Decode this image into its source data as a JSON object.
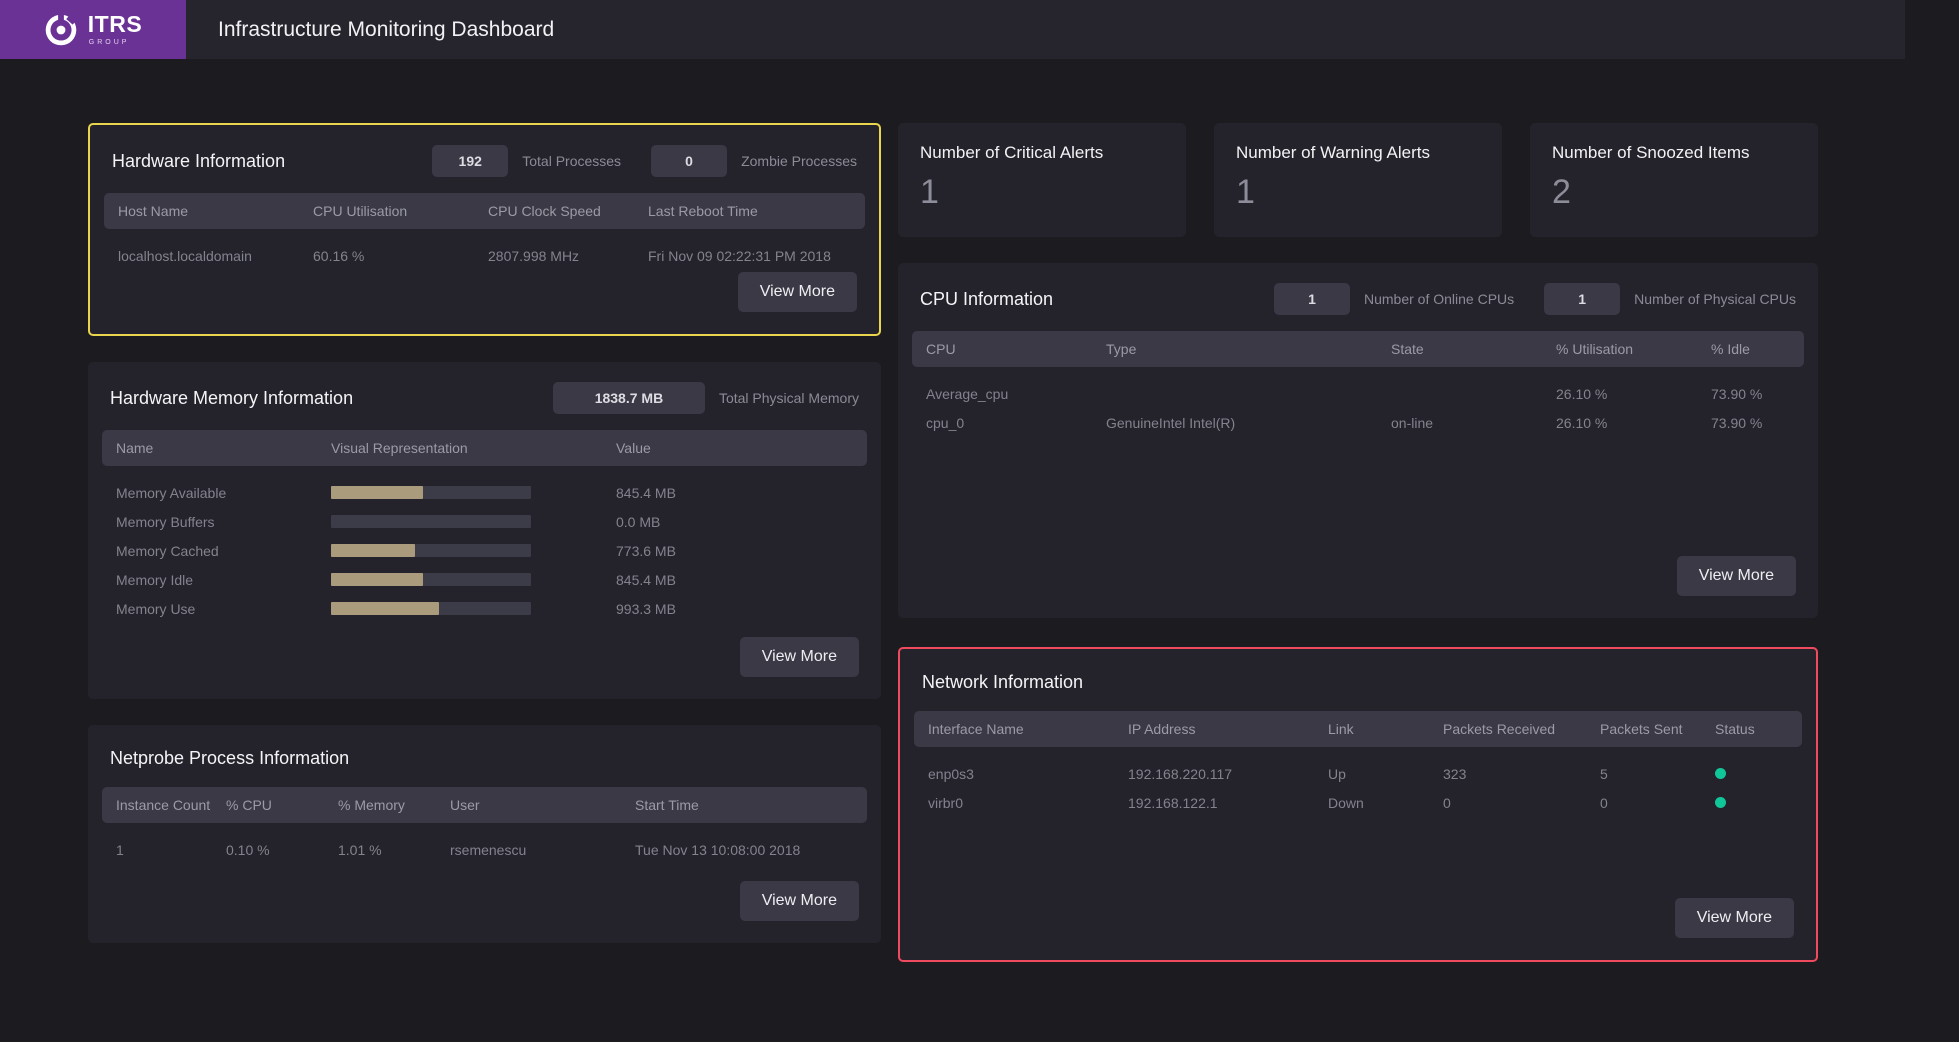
{
  "header": {
    "brand_name": "ITRS",
    "brand_sub": "GROUP",
    "brand_color": "#6b3296",
    "title": "Infrastructure Monitoring Dashboard"
  },
  "common": {
    "view_more_label": "View More",
    "status_dot_color": "#10c79a"
  },
  "hardware_information": {
    "title": "Hardware Information",
    "border_color": "#e8d44d",
    "kpis": [
      {
        "value": "192",
        "label": "Total Processes"
      },
      {
        "value": "0",
        "label": "Zombie Processes"
      }
    ],
    "columns": [
      "Host Name",
      "CPU Utilisation",
      "CPU Clock Speed",
      "Last Reboot Time"
    ],
    "rows": [
      {
        "host_name": "localhost.localdomain",
        "cpu_utilisation": "60.16 %",
        "cpu_clock_speed": "2807.998 MHz",
        "last_reboot_time": "Fri Nov 09 02:22:31 PM 2018"
      }
    ]
  },
  "hardware_memory_information": {
    "title": "Hardware Memory Information",
    "kpis": [
      {
        "value": "1838.7 MB",
        "label": "Total Physical Memory"
      }
    ],
    "columns": [
      "Name",
      "Visual Representation",
      "Value"
    ],
    "rows": [
      {
        "name": "Memory Available",
        "percent": 46,
        "value": "845.4 MB"
      },
      {
        "name": "Memory Buffers",
        "percent": 0,
        "value": "0.0 MB"
      },
      {
        "name": "Memory Cached",
        "percent": 42,
        "value": "773.6 MB"
      },
      {
        "name": "Memory Idle",
        "percent": 46,
        "value": "845.4 MB"
      },
      {
        "name": "Memory Use",
        "percent": 54,
        "value": "993.3 MB"
      }
    ]
  },
  "netprobe_process_information": {
    "title": "Netprobe Process Information",
    "columns": [
      "Instance Count",
      "% CPU",
      "% Memory",
      "User",
      "Start Time"
    ],
    "rows": [
      {
        "instance_count": "1",
        "pct_cpu": "0.10 %",
        "pct_memory": "1.01 %",
        "user": "rsemenescu",
        "start_time": "Tue Nov 13 10:08:00 2018"
      }
    ]
  },
  "stat_cards": [
    {
      "title": "Number of Critical Alerts",
      "value": "1"
    },
    {
      "title": "Number of Warning Alerts",
      "value": "1"
    },
    {
      "title": "Number of Snoozed Items",
      "value": "2"
    }
  ],
  "cpu_information": {
    "title": "CPU Information",
    "kpis": [
      {
        "value": "1",
        "label": "Number of Online CPUs"
      },
      {
        "value": "1",
        "label": "Number of Physical CPUs"
      }
    ],
    "columns": [
      "CPU",
      "Type",
      "State",
      "% Utilisation",
      "% Idle"
    ],
    "rows": [
      {
        "cpu": "Average_cpu",
        "type": "",
        "state": "",
        "utilisation": "26.10 %",
        "idle": "73.90 %"
      },
      {
        "cpu": "cpu_0",
        "type": "GenuineIntel Intel(R)",
        "state": "on-line",
        "utilisation": "26.10 %",
        "idle": "73.90 %"
      }
    ]
  },
  "network_information": {
    "title": "Network Information",
    "border_color": "#ef4a5e",
    "columns": [
      "Interface Name",
      "IP Address",
      "Link",
      "Packets Received",
      "Packets Sent",
      "Status"
    ],
    "rows": [
      {
        "interface": "enp0s3",
        "ip": "192.168.220.117",
        "link": "Up",
        "link_state": "up",
        "received": "323",
        "sent": "5"
      },
      {
        "interface": "virbr0",
        "ip": "192.168.122.1",
        "link": "Down",
        "link_state": "down",
        "received": "0",
        "sent": "0"
      }
    ]
  }
}
